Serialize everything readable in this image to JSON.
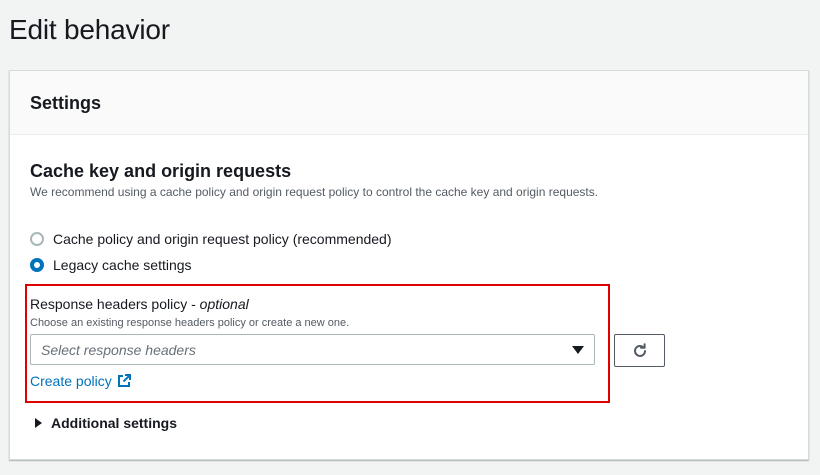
{
  "page": {
    "title": "Edit behavior"
  },
  "panel": {
    "title": "Settings"
  },
  "section": {
    "title": "Cache key and origin requests",
    "description": "We recommend using a cache policy and origin request policy to control the cache key and origin requests."
  },
  "radios": [
    {
      "label": "Cache policy and origin request policy (recommended)",
      "checked": false
    },
    {
      "label": "Legacy cache settings",
      "checked": true
    }
  ],
  "response_headers": {
    "label": "Response headers policy",
    "label_suffix": "optional",
    "description": "Choose an existing response headers policy or create a new one.",
    "placeholder": "Select response headers",
    "create_link": "Create policy"
  },
  "additional": {
    "label": "Additional settings"
  },
  "colors": {
    "accent": "#0073bb",
    "highlight": "#e00000"
  }
}
